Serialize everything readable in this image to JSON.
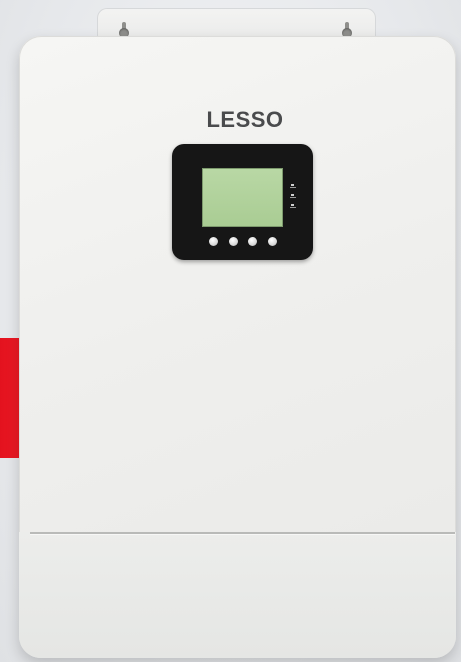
{
  "device": {
    "brand": "LESSO",
    "body_color": "#efefed",
    "panel_color": "#161616",
    "lcd_color": "#b9d8a5",
    "accent_color": "#e3121e",
    "icons": [
      "mounting-bracket-icon",
      "lcd-screen-icon",
      "status-led-icon",
      "control-button-icon"
    ],
    "buttons": [
      "button-1",
      "button-2",
      "button-3",
      "button-4"
    ]
  }
}
